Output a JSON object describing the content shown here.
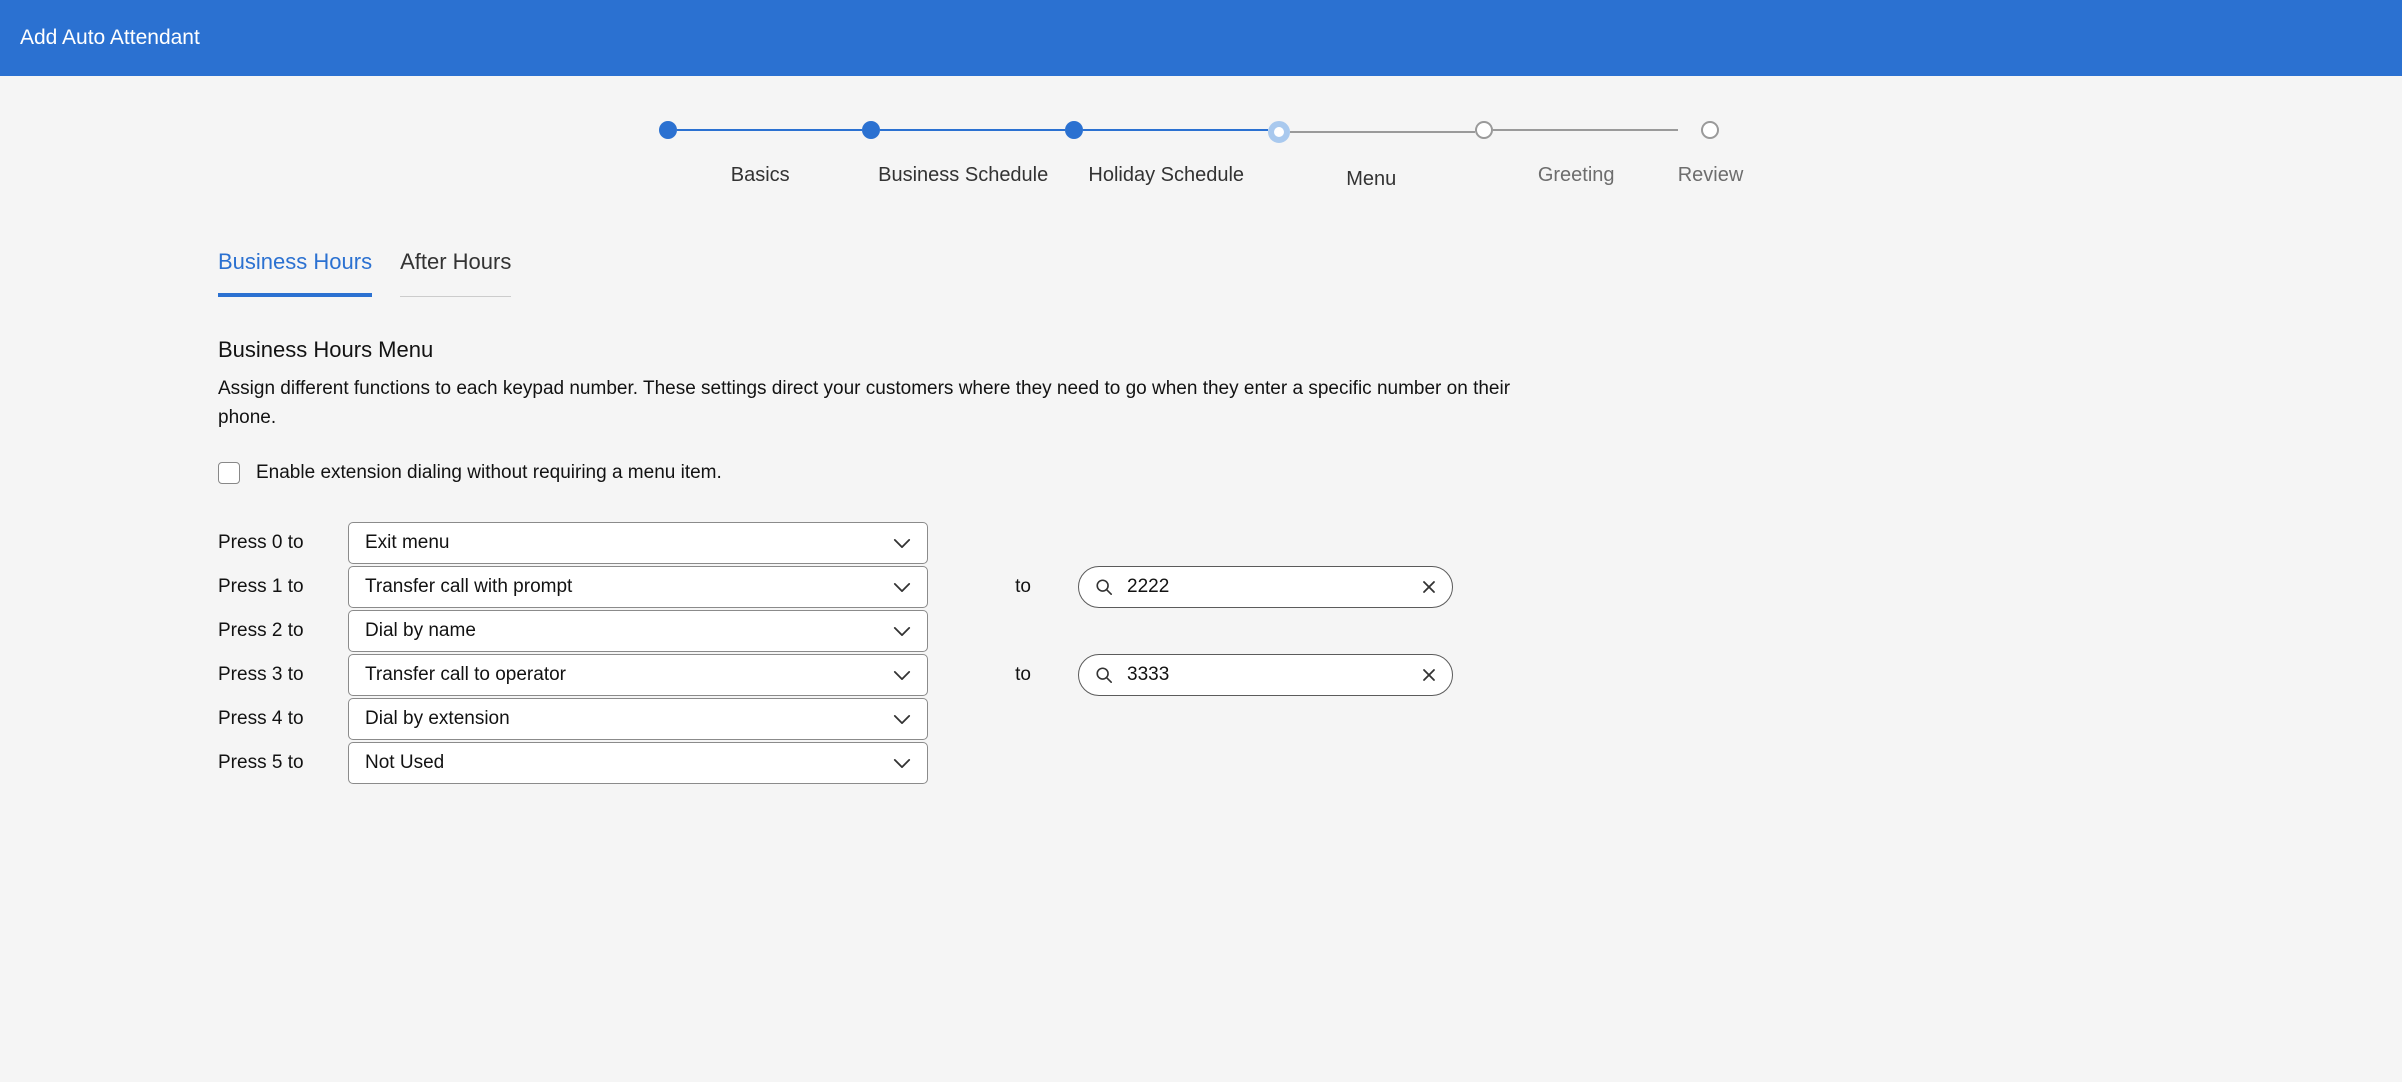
{
  "header": {
    "title": "Add Auto Attendant"
  },
  "stepper": {
    "steps": [
      {
        "label": "Basics",
        "state": "done"
      },
      {
        "label": "Business Schedule",
        "state": "done"
      },
      {
        "label": "Holiday Schedule",
        "state": "done"
      },
      {
        "label": "Menu",
        "state": "current"
      },
      {
        "label": "Greeting",
        "state": "future"
      },
      {
        "label": "Review",
        "state": "future"
      }
    ]
  },
  "tabs": {
    "business": "Business Hours",
    "after": "After Hours",
    "active": "business"
  },
  "section": {
    "title": "Business Hours Menu",
    "desc": "Assign different functions to each keypad number. These settings direct your customers where they need to go when they enter a specific number on their phone."
  },
  "checkbox": {
    "label": "Enable extension dialing without requiring a menu item.",
    "checked": false
  },
  "to_label": "to",
  "rows": [
    {
      "label": "Press 0 to",
      "action": "Exit menu",
      "has_to": false
    },
    {
      "label": "Press 1 to",
      "action": "Transfer call with prompt",
      "has_to": true,
      "to_value": "2222"
    },
    {
      "label": "Press 2 to",
      "action": "Dial by name",
      "has_to": false
    },
    {
      "label": "Press 3 to",
      "action": "Transfer call to operator",
      "has_to": true,
      "to_value": "3333"
    },
    {
      "label": "Press 4 to",
      "action": "Dial by extension",
      "has_to": false
    },
    {
      "label": "Press 5 to",
      "action": "Not Used",
      "has_to": false
    }
  ]
}
